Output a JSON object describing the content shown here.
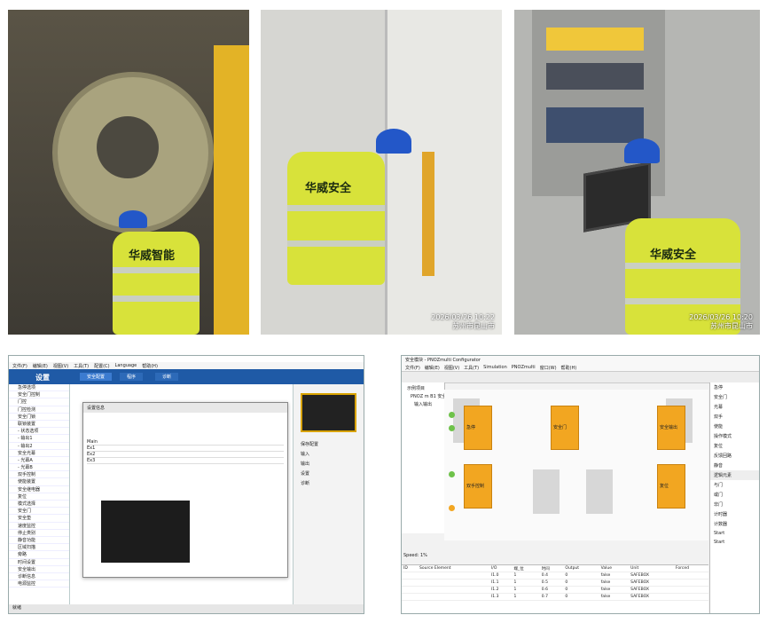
{
  "photos": [
    {
      "vest_text": "华威智能",
      "stamp": ""
    },
    {
      "vest_text": "华威安全",
      "stamp": "2026/03/26 10:22\n苏州市昆山市"
    },
    {
      "vest_text": "华威安全",
      "stamp": "2026/03/26 10:20\n苏州市昆山市"
    }
  ],
  "screenshot1": {
    "title": "设置",
    "menu": [
      "文件(F)",
      "编辑(E)",
      "视图(V)",
      "工具(T)",
      "配置(C)",
      "Language",
      "帮助(H)"
    ],
    "ribbon_buttons": [
      "安全配置",
      "程序",
      "诊断"
    ],
    "sidebar_items": [
      "急停选项",
      "安全门控制",
      "门控",
      "门控检测",
      "安全门锁",
      "联锁装置",
      "- 状态选项",
      "- 输出1",
      "- 输出2",
      "安全光幕",
      "- 光幕A",
      "- 光幕B",
      "双手控制",
      "使能装置",
      "安全继电器",
      "复位",
      "模式选择",
      "安全门",
      "安全垫",
      "速度监控",
      "停止类别",
      "静音功能",
      "区域扫描",
      "旁路",
      "时间设置",
      "安全输出",
      "诊断信息",
      "电源监控"
    ],
    "dialog_title": "设置信息",
    "dialog_rows": [
      "Main",
      "Ex1",
      "Ex2",
      "Ex3"
    ],
    "right_panel": [
      "保存配置",
      "输入",
      "输出",
      "设置",
      "诊断"
    ],
    "status": "就绪"
  },
  "screenshot2": {
    "title": "安全模块 - PNOZmulti Configurator",
    "menu": [
      "文件(F)",
      "编辑(E)",
      "视图(V)",
      "工具(T)",
      "Simulation",
      "PNOZmulti",
      "窗口(W)",
      "帮助(H)"
    ],
    "tree": [
      "示例项目",
      "PNOZ m B1 安全控制器",
      "输入输出"
    ],
    "blocks": [
      "急停",
      "安全门",
      "安全输出",
      "双手控制",
      "复位"
    ],
    "lib_items": [
      "急停",
      "安全门",
      "光幕",
      "双手",
      "使能",
      "操作模式",
      "复位",
      "反馈回路",
      "静音",
      "逻辑元素",
      "与门",
      "或门",
      "非门",
      "计时器",
      "计数器",
      "Start",
      "Start"
    ],
    "speed_label": "Speed: 1%",
    "table_headers": [
      "ID",
      "Source Element",
      "I/O",
      "端_位",
      "时间",
      "Output",
      "Value",
      "Unit",
      "Forced"
    ],
    "table_rows": [
      [
        "",
        "",
        "I1.0",
        "1",
        "0.4",
        "0",
        "false",
        "SAFEBOX",
        ""
      ],
      [
        "",
        "",
        "I1.1",
        "1",
        "0.5",
        "0",
        "false",
        "SAFEBOX",
        ""
      ],
      [
        "",
        "",
        "I1.2",
        "1",
        "0.6",
        "0",
        "false",
        "SAFEBOX",
        ""
      ],
      [
        "",
        "",
        "I1.3",
        "1",
        "0.7",
        "0",
        "false",
        "SAFEBOX",
        ""
      ]
    ]
  },
  "colors": {
    "vest": "#d8e23a",
    "helmet": "#2357c8",
    "ribbon": "#1f5aa6",
    "block": "#f2a621",
    "dot": "#6ec24a"
  }
}
